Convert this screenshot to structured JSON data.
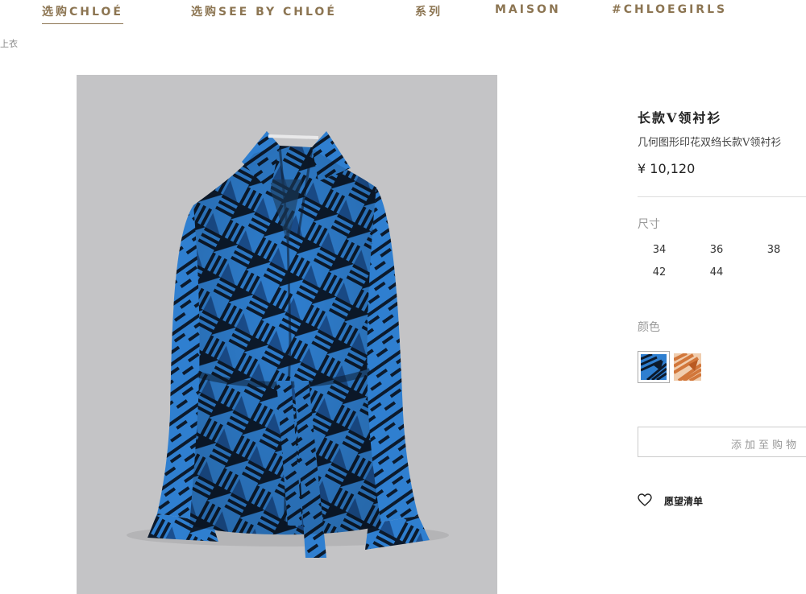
{
  "nav": {
    "items": [
      {
        "label": "选购CHLOÉ"
      },
      {
        "label": "选购SEE BY CHLOÉ"
      },
      {
        "label": "系列"
      },
      {
        "label": "MAISON"
      },
      {
        "label": "#CHLOEGIRLS"
      }
    ]
  },
  "breadcrumb": "上衣",
  "product": {
    "title": "长款V领衬衫",
    "subtitle": "几何图形印花双绉长款V领衬衫",
    "price": "¥ 10,120",
    "size_label": "尺寸",
    "sizes": [
      "34",
      "36",
      "38",
      "42",
      "44"
    ],
    "color_label": "颜色",
    "colors": {
      "blue": "#2f7fd0",
      "orange": "#d2773b"
    },
    "add_to_cart": "添加至购物",
    "wishlist": "愿望清单"
  }
}
